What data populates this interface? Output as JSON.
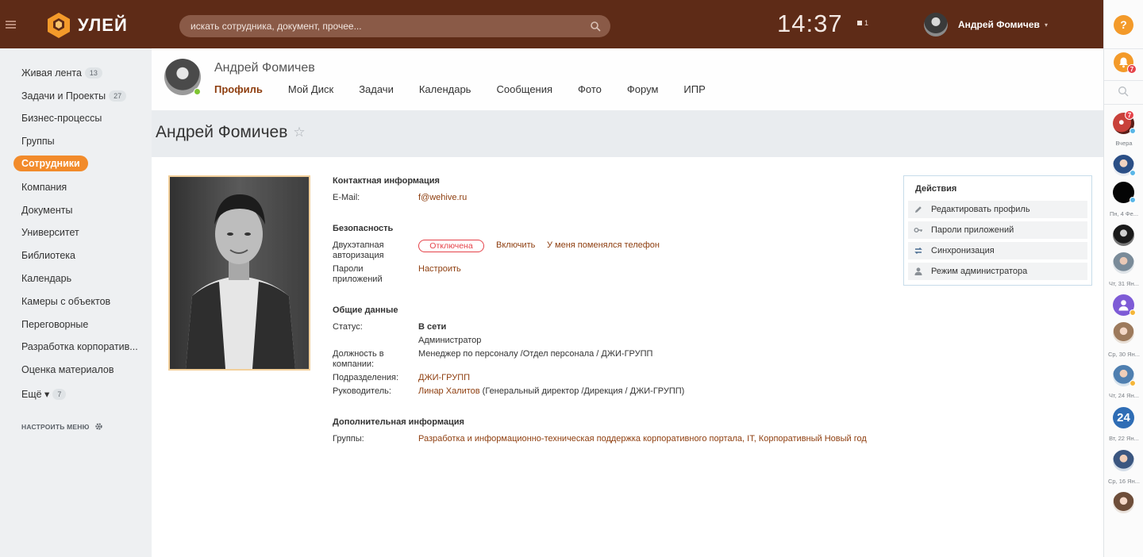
{
  "header": {
    "logo_text": "УЛЕЙ",
    "search_placeholder": "искать сотрудника, документ, прочее...",
    "clock": "14:37",
    "flag_count": "1",
    "user_name": "Андрей Фомичев",
    "caret": "▾",
    "help_label": "?"
  },
  "left_menu": {
    "items": [
      {
        "label": "Живая лента",
        "count": "13"
      },
      {
        "label": "Задачи и Проекты",
        "count": "27"
      },
      {
        "label": "Бизнес-процессы"
      },
      {
        "label": "Группы"
      },
      {
        "label": "Сотрудники",
        "active": true
      },
      {
        "label": "Компания"
      },
      {
        "label": "Документы"
      },
      {
        "label": "Университет"
      },
      {
        "label": "Библиотека"
      },
      {
        "label": "Календарь"
      },
      {
        "label": "Камеры с объектов"
      },
      {
        "label": "Переговорные"
      },
      {
        "label": "Разработка корпоратив..."
      },
      {
        "label": "Оценка материалов"
      },
      {
        "label": "Ещё ▾",
        "count": "7"
      }
    ],
    "setup_label": "НАСТРОИТЬ МЕНЮ"
  },
  "profile_header": {
    "name": "Андрей Фомичев",
    "tabs": [
      "Профиль",
      "Мой Диск",
      "Задачи",
      "Календарь",
      "Сообщения",
      "Фото",
      "Форум",
      "ИПР"
    ],
    "active_tab": "Профиль"
  },
  "page_title": "Андрей Фомичев",
  "star": "☆",
  "contact": {
    "title": "Контактная информация",
    "email_label": "E-Mail:",
    "email": "f@wehive.ru"
  },
  "security": {
    "title": "Безопасность",
    "twofa_label": "Двухэтапная авторизация",
    "twofa_status": "Отключена",
    "enable_link": "Включить",
    "phone_link": "У меня поменялся телефон",
    "app_passwords_label": "Пароли приложений",
    "setup_link": "Настроить"
  },
  "general": {
    "title": "Общие данные",
    "status_label": "Статус:",
    "status_value": "В сети",
    "role": "Администратор",
    "position_label": "Должность в компании:",
    "position_value": "Менеджер по персоналу /Отдел персонала / ДЖИ-ГРУПП",
    "department_label": "Подразделения:",
    "department_value": "ДЖИ-ГРУПП",
    "manager_label": "Руководитель:",
    "manager_name": "Линар Халитов",
    "manager_details": " (Генеральный директор /Дирекция / ДЖИ-ГРУПП)"
  },
  "extra": {
    "title": "Дополнительная информация",
    "groups_label": "Группы:",
    "groups_value": "Разработка и информационно-техническая поддержка корпоративного портала, IT, Корпоративный Новый год"
  },
  "actions": {
    "title": "Действия",
    "items": [
      "Редактировать профиль",
      "Пароли приложений",
      "Синхронизация",
      "Режим администратора"
    ]
  },
  "right_rail": {
    "notification_count": "7",
    "chat_badge": "7",
    "dates": [
      "Вчера",
      "Пн, 4 Фе...",
      "Чт, 31 Ян...",
      "Ср, 30 Ян...",
      "Чт, 24 Ян...",
      "Вт, 22 Ян...",
      "Ср, 16 Ян..."
    ],
    "b24_label": "24"
  },
  "colors": {
    "header_bg": "#5e2b17",
    "accent": "#f28b2b",
    "link": "#8e3e0f",
    "danger": "#e5434a"
  }
}
